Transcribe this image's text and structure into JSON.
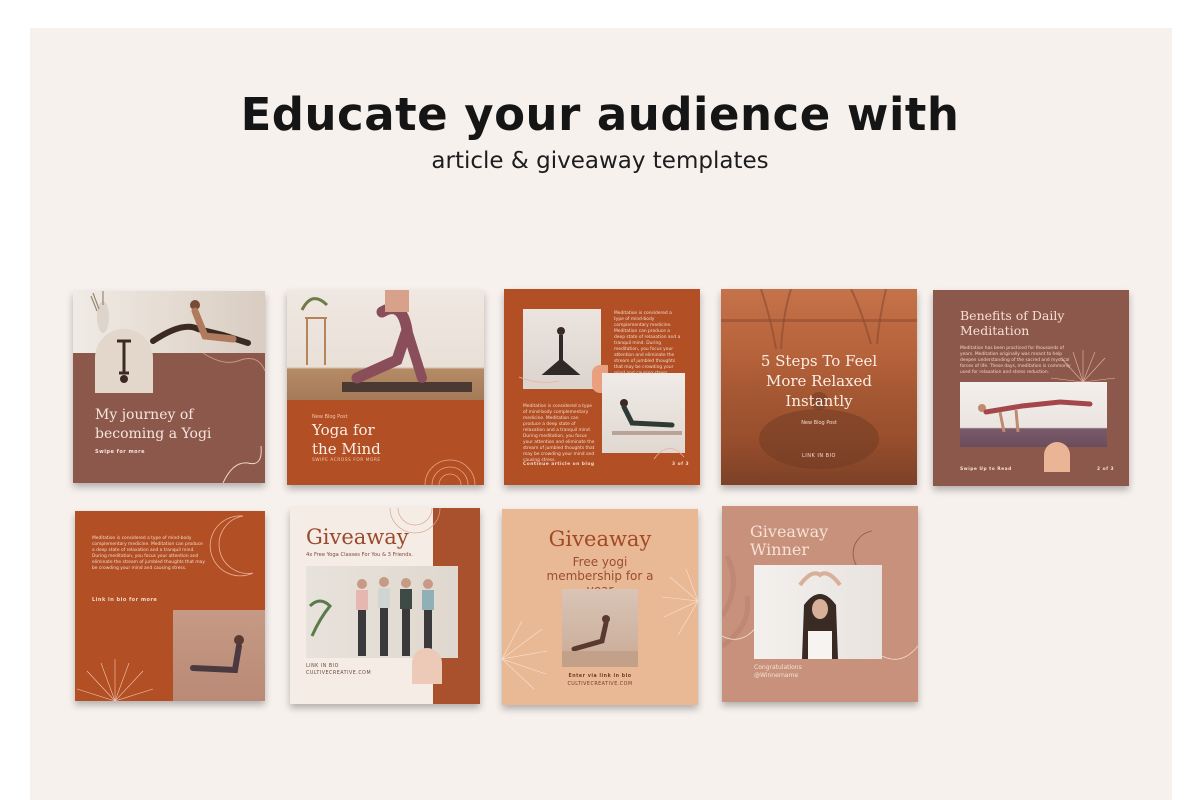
{
  "heading": {
    "title": "Educate your audience with",
    "subtitle": "article & giveaway templates"
  },
  "colors": {
    "background": "#f7f1ee",
    "mauve_brown": "#8d584c",
    "terracotta": "#b24f25",
    "peach": "#e9b996",
    "dusty_rose": "#c8917c",
    "cream": "#f6ece6"
  },
  "templates": [
    {
      "title": "My journey of becoming a Yogi",
      "cta": "Swipe for more"
    },
    {
      "tag": "New Blog Post",
      "title": "Yoga for the Mind",
      "cta": "SWIPE ACROSS FOR MORE"
    },
    {
      "body_top": "Meditation is considered a type of mind-body complementary medicine. Meditation can produce a deep state of relaxation and a tranquil mind. During meditation, you focus your attention and eliminate the stream of jumbled thoughts that may be crowding your mind and causing stress.",
      "body_bottom": "Meditation is considered a type of mind-body complementary medicine. Meditation can produce a deep state of relaxation and a tranquil mind. During meditation, you focus your attention and eliminate the stream of jumbled thoughts that may be crowding your mind and causing stress.",
      "cta": "Continue article on blog",
      "page": "3 of 3"
    },
    {
      "title": "5 Steps To Feel More Relaxed Instantly",
      "tag": "New Blog Post",
      "cta": "LINK IN BIO"
    },
    {
      "title": "Benefits of Daily Meditation",
      "body": "Meditation has been practiced for thousands of years. Meditation originally was meant to help deepen understanding of the sacred and mystical forces of life. These days, meditation is commonly used for relaxation and stress reduction.",
      "cta": "Swipe Up to Read",
      "page": "2 of 3"
    },
    {
      "body": "Meditation is considered a type of mind-body complementary medicine. Meditation can produce a deep state of relaxation and a tranquil mind. During meditation, you focus your attention and eliminate the stream of jumbled thoughts that may be crowding your mind and causing stress.",
      "cta": "Link in bio for more"
    },
    {
      "title": "Giveaway",
      "subtitle": "4x Free Yoga Classes For You & 3 Friends.",
      "cta": "LINK IN BIO",
      "site": "CULTIVECREATIVE.COM"
    },
    {
      "title": "Giveaway",
      "subtitle": "Free yogi membership for a year",
      "cta": "Enter via link in bio",
      "site": "CULTIVECREATIVE.COM"
    },
    {
      "title": "Giveaway Winner",
      "congrats": "Congratulations",
      "handle": "@Winnername"
    }
  ]
}
